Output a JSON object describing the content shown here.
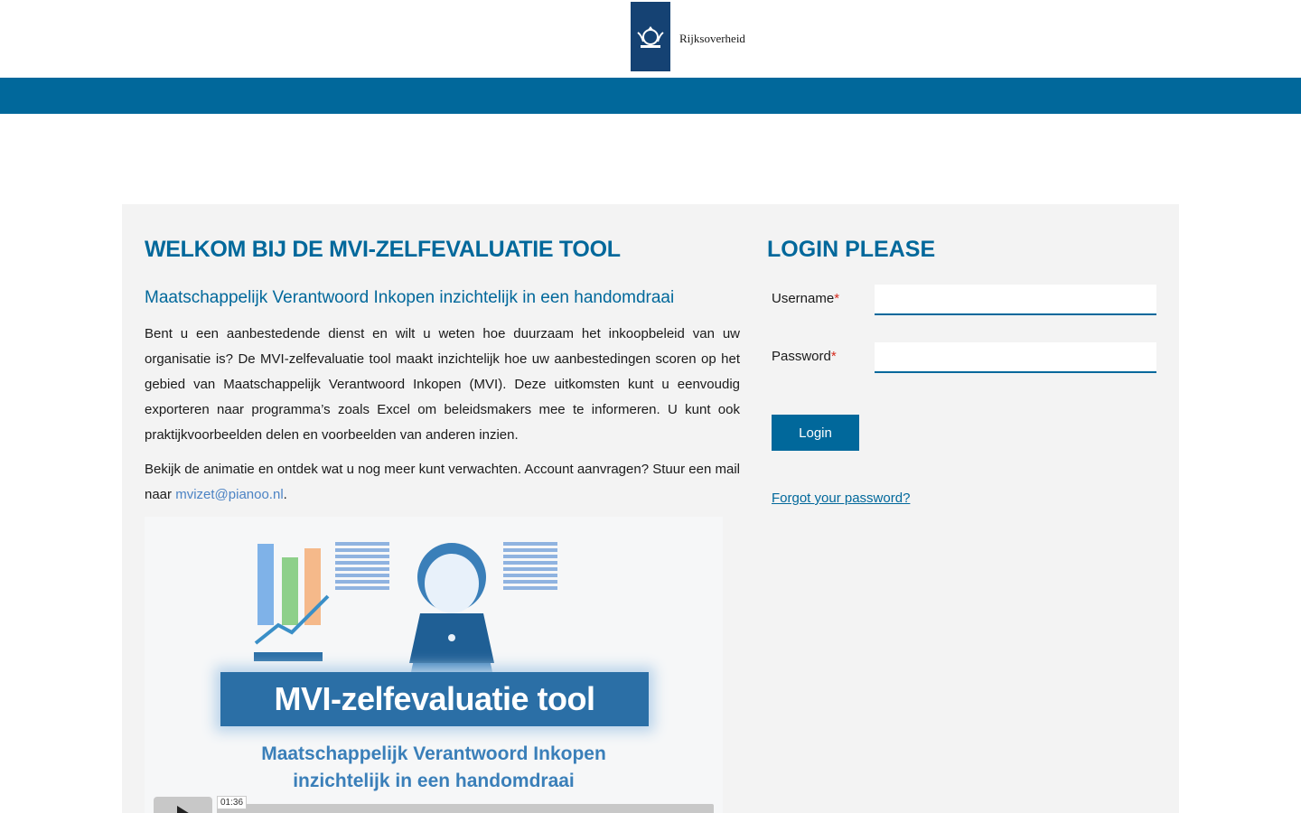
{
  "header": {
    "logo_text": "Rijksoverheid"
  },
  "welcome": {
    "title": "WELKOM BIJ DE MVI-ZELFEVALUATIE TOOL",
    "subtitle": "Maatschappelijk Verantwoord Inkopen inzichtelijk in een handomdraai",
    "intro": "Bent u een aanbestedende dienst en wilt u weten hoe duurzaam het inkoopbeleid van uw organisatie is? De MVI-zelfevaluatie tool maakt inzichtelijk hoe uw aanbestedingen scoren op het gebied van Maatschappelijk Verantwoord Inkopen (MVI). Deze uitkomsten kunt u eenvoudig exporteren naar programma’s zoals Excel om beleidsmakers mee te informeren. U kunt ook praktijkvoorbeelden delen en voorbeelden van anderen inzien.",
    "para2_text": "Bekijk de animatie en ontdek wat u nog meer kunt verwachten. Account aanvragen? Stuur een mail naar",
    "mail_link": "mvizet@pianoo.nl",
    "para2_end": "."
  },
  "video": {
    "banner_title": "MVI-zelfevaluatie tool",
    "caption_line1": "Maatschappelijk Verantwoord Inkopen",
    "caption_line2": "inzichtelijk in een handomdraai",
    "duration": "01:36"
  },
  "login": {
    "title": "LOGIN PLEASE",
    "username_label": "Username",
    "password_label": "Password",
    "required_marker": "*",
    "username_value": "",
    "password_value": "",
    "login_button": "Login",
    "forgot_link": "Forgot your password?"
  },
  "colors": {
    "brand_blue": "#01689b",
    "logo_navy": "#154273",
    "panel_bg": "#f3f3f3",
    "required_red": "#d52b1e"
  },
  "icons": [
    "rijksoverheid-emblem-icon",
    "play-icon"
  ]
}
